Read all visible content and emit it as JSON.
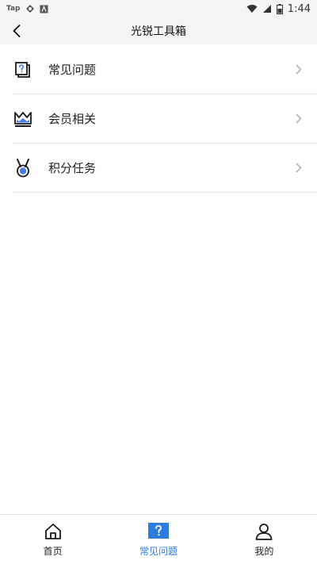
{
  "status_bar": {
    "app_tag": "Tap",
    "time": "1:44"
  },
  "header": {
    "title": "光锐工具箱"
  },
  "menu": {
    "items": [
      {
        "label": "常见问题",
        "icon": "question-doc-icon"
      },
      {
        "label": "会员相关",
        "icon": "crown-icon"
      },
      {
        "label": "积分任务",
        "icon": "medal-icon"
      }
    ]
  },
  "bottom_nav": {
    "items": [
      {
        "label": "首页",
        "icon": "home-icon"
      },
      {
        "label": "常见问题",
        "icon": "question-icon"
      },
      {
        "label": "我的",
        "icon": "user-icon"
      }
    ],
    "active_index": 1
  },
  "colors": {
    "accent": "#2e7bde",
    "icon_blue": "#4a7be6",
    "divider": "#e6e6e6",
    "header_bg": "#f5f5f5"
  }
}
